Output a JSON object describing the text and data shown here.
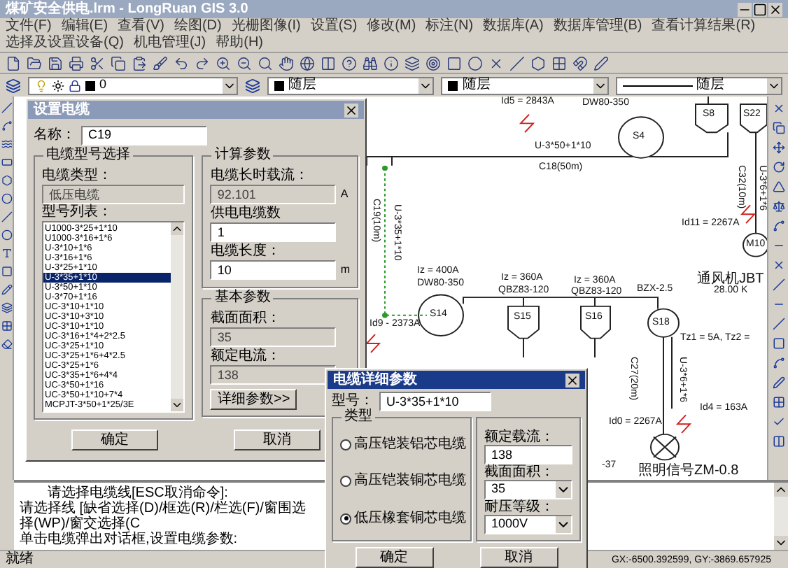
{
  "window": {
    "title": "煤矿安全供电.lrm - LongRuan GIS 3.0"
  },
  "menu": [
    {
      "label": "文件(F)"
    },
    {
      "label": "编辑(E)"
    },
    {
      "label": "查看(V)"
    },
    {
      "label": "绘图(D)"
    },
    {
      "label": "光栅图像(I)"
    },
    {
      "label": "设置(S)"
    },
    {
      "label": "修改(M)"
    },
    {
      "label": "标注(N)"
    },
    {
      "label": "数据库(A)"
    },
    {
      "label": "数据库管理(B)"
    },
    {
      "label": "查看计算结果(R)"
    },
    {
      "label": "选择及设置设备(Q)"
    },
    {
      "label": "机电管理(J)"
    },
    {
      "label": "帮助(H)"
    }
  ],
  "layer_bar": {
    "layer": "0",
    "combos": [
      {
        "text": "随层",
        "kind": "swatch"
      },
      {
        "text": "随层",
        "kind": "swatch"
      },
      {
        "text": "随层",
        "kind": "line"
      }
    ]
  },
  "drawing": {
    "labels": [
      {
        "text": "Id5 = 2843A",
        "kind": "horizontal"
      },
      {
        "text": "DW80-350",
        "kind": "horizontal"
      },
      {
        "text": "S4",
        "kind": "horizontal"
      },
      {
        "text": "S8",
        "kind": "horizontal"
      },
      {
        "text": "S22",
        "kind": "horizontal"
      },
      {
        "text": "U-3*50+1*10",
        "kind": "horizontal"
      },
      {
        "text": "C18(50m)",
        "kind": "horizontal"
      },
      {
        "text": "C19(10m)",
        "kind": "vertical"
      },
      {
        "text": "U-3*35+1*10",
        "kind": "vertical"
      },
      {
        "text": "C32(10m)",
        "kind": "vertical"
      },
      {
        "text": "U-3*6+1*6",
        "kind": "vertical"
      },
      {
        "text": "Id11 = 2267A",
        "kind": "horizontal"
      },
      {
        "text": "M10",
        "kind": "horizontal"
      },
      {
        "text": "通风机JBT",
        "kind": "horizontal"
      },
      {
        "text": "28.00 K",
        "kind": "horizontal"
      },
      {
        "text": "Iz = 400A",
        "kind": "horizontal"
      },
      {
        "text": "DW80-350",
        "kind": "horizontal"
      },
      {
        "text": "S14",
        "kind": "horizontal"
      },
      {
        "text": "Id9 - 2373A",
        "kind": "horizontal"
      },
      {
        "text": "Iz = 360A",
        "kind": "horizontal"
      },
      {
        "text": "QBZ83-120",
        "kind": "horizontal"
      },
      {
        "text": "S15",
        "kind": "horizontal"
      },
      {
        "text": "Iz = 360A",
        "kind": "horizontal"
      },
      {
        "text": "QBZ83-120",
        "kind": "horizontal"
      },
      {
        "text": "S16",
        "kind": "horizontal"
      },
      {
        "text": "BZX-2.5",
        "kind": "horizontal"
      },
      {
        "text": "S18",
        "kind": "horizontal"
      },
      {
        "text": "Tz1 = 5A, Tz2 =",
        "kind": "horizontal"
      },
      {
        "text": "C27(20m)",
        "kind": "vertical"
      },
      {
        "text": "U-3*6+1*6",
        "kind": "vertical"
      },
      {
        "text": "Id4 = 163A",
        "kind": "horizontal"
      },
      {
        "text": "Id0 = 2267A",
        "kind": "horizontal"
      },
      {
        "text": "-37",
        "kind": "horizontal"
      },
      {
        "text": "照明信号ZM-0.8",
        "kind": "horizontal"
      }
    ]
  },
  "cable_dialog": {
    "title": "设置电缆",
    "name_label": "名称：",
    "name": "C19",
    "model_group": "电缆型号选择",
    "type_label": "电缆类型：",
    "type": {
      "value": "低压电缆",
      "disabled": true
    },
    "list_label": "型号列表：",
    "models": [
      {
        "text": "U1000-3*25+1*10",
        "selected": false
      },
      {
        "text": "U1000-3*16+1*6",
        "selected": false
      },
      {
        "text": "U-3*10+1*6",
        "selected": false
      },
      {
        "text": "U-3*16+1*6",
        "selected": false
      },
      {
        "text": "U-3*25+1*10",
        "selected": false
      },
      {
        "text": "U-3*35+1*10",
        "selected": true
      },
      {
        "text": "U-3*50+1*10",
        "selected": false
      },
      {
        "text": "U-3*70+1*16",
        "selected": false
      },
      {
        "text": "UC-3*10+1*10",
        "selected": false
      },
      {
        "text": "UC-3*10+3*10",
        "selected": false
      },
      {
        "text": "UC-3*10+1*10",
        "selected": false
      },
      {
        "text": "UC-3*16+1*4+2*2.5",
        "selected": false
      },
      {
        "text": "UC-3*25+1*10",
        "selected": false
      },
      {
        "text": "UC-3*25+1*6+4*2.5",
        "selected": false
      },
      {
        "text": "UC-3*25+1*6",
        "selected": false
      },
      {
        "text": "UC-3*35+1*6+4*4",
        "selected": false
      },
      {
        "text": "UC-3*50+1*16",
        "selected": false
      },
      {
        "text": "UC-3*50+1*10+7*4",
        "selected": false
      },
      {
        "text": "MCPJT-3*50+1*25/3E",
        "selected": false
      }
    ],
    "calc_group": "计算参数",
    "calc_fields": [
      {
        "label": "电缆长时载流：",
        "value": "92.101",
        "unit": "A",
        "disabled": true
      },
      {
        "label": "供电电缆数",
        "value": "1",
        "disabled": false
      },
      {
        "label": "电缆长度：",
        "value": "10",
        "unit": "m",
        "disabled": false
      }
    ],
    "basic_group": "基本参数",
    "basic_fields": [
      {
        "label": "截面面积：",
        "value": "35",
        "disabled": true
      },
      {
        "label": "额定电流：",
        "value": "138",
        "disabled": true
      }
    ],
    "detail_button": "详细参数>>",
    "ok": "确定",
    "cancel": "取消"
  },
  "detail_dialog": {
    "title": "电缆详细参数",
    "model_label": "型号：",
    "model": "U-3*35+1*10",
    "type_group": "类型",
    "types": [
      {
        "label": "高压铠装铝芯电缆",
        "selected": false
      },
      {
        "label": "高压铠装铜芯电缆",
        "selected": false
      },
      {
        "label": "低压橡套铜芯电缆",
        "selected": true
      }
    ],
    "fields": [
      {
        "label": "额定载流：",
        "value": "138",
        "kind": "text"
      },
      {
        "label": "截面面积：",
        "value": "35",
        "kind": "combo"
      },
      {
        "label": "耐压等级：",
        "value": "1000V",
        "kind": "combo"
      }
    ],
    "ok": "确定",
    "cancel": "取消"
  },
  "command": {
    "lines": [
      "请选择电缆线[ESC取消命令]:",
      "请选择线 [缺省选择(D)/框选(R)/栏选(F)/窗围选择(WP)/窗交选择(C",
      "单击电缆弹出对话框,设置电缆参数:"
    ]
  },
  "status_bar": {
    "state": "就绪",
    "coordinates": "GX:-6500.392599, GY:-3869.657925"
  }
}
